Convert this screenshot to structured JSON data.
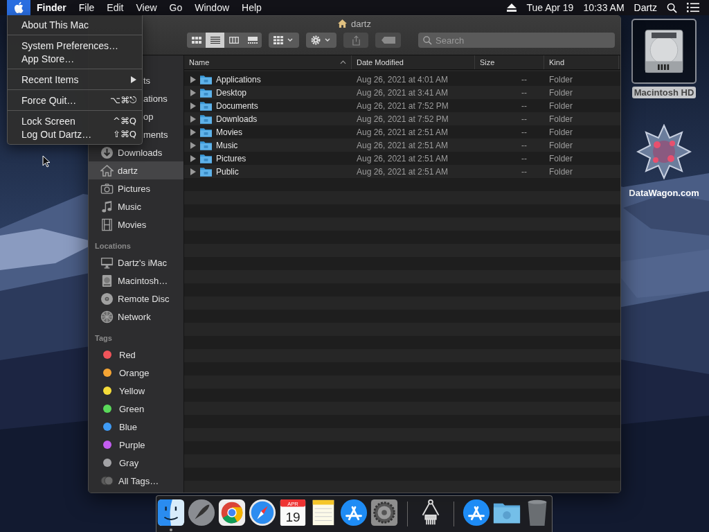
{
  "menu_bar": {
    "apple_selected": true,
    "app_name": "Finder",
    "menus": [
      "File",
      "Edit",
      "View",
      "Go",
      "Window",
      "Help"
    ],
    "date": "Tue Apr 19",
    "time": "10:33 AM",
    "user": "Dartz"
  },
  "apple_menu": {
    "groups": [
      [
        {
          "label": "About This Mac",
          "submenu": false
        }
      ],
      [
        {
          "label": "System Preferences…",
          "submenu": false
        },
        {
          "label": "App Store…",
          "submenu": false
        }
      ],
      [
        {
          "label": "Recent Items",
          "submenu": true
        }
      ],
      [
        {
          "label": "Force Quit…",
          "submenu": false,
          "shortcut": "⌥⌘⎋"
        }
      ],
      [
        {
          "label": "Lock Screen",
          "submenu": false,
          "shortcut": "^⌘Q"
        },
        {
          "label": "Log Out Dartz…",
          "submenu": false,
          "shortcut": "⇧⌘Q"
        }
      ]
    ]
  },
  "desktop_icons": [
    {
      "label": "Macintosh HD",
      "selected": true
    },
    {
      "label": "DataWagon.com",
      "selected": false
    }
  ],
  "finder_window": {
    "title": "dartz",
    "view_modes": [
      {
        "selected": false
      },
      {
        "selected": true
      },
      {
        "selected": false
      },
      {
        "selected": false
      }
    ],
    "toolbar_buttons": [
      {
        "kind": "group",
        "disabled": false
      },
      {
        "kind": "action",
        "disabled": false
      },
      {
        "kind": "share",
        "disabled": true
      },
      {
        "kind": "tags",
        "disabled": true
      }
    ],
    "search": {
      "placeholder": "Search"
    },
    "sidebar": [
      {
        "items": [
          {
            "kind": "covered",
            "label": "ts",
            "selected": false
          },
          {
            "kind": "covered",
            "label": "ations",
            "selected": false
          },
          {
            "kind": "covered",
            "label": "op",
            "selected": false
          },
          {
            "kind": "covered",
            "label": "ments",
            "selected": false
          },
          {
            "kind": "item",
            "label": "Downloads",
            "selected": false
          },
          {
            "kind": "item",
            "label": "dartz",
            "selected": true
          },
          {
            "kind": "item",
            "label": "Pictures",
            "selected": false
          },
          {
            "kind": "item",
            "label": "Music",
            "selected": false
          },
          {
            "kind": "item",
            "label": "Movies",
            "selected": false
          }
        ]
      },
      {
        "header": "Locations",
        "items": [
          {
            "kind": "item",
            "label": "Dartz's iMac",
            "selected": false
          },
          {
            "kind": "item",
            "label": "Macintosh…",
            "selected": false
          },
          {
            "kind": "item",
            "label": "Remote Disc",
            "selected": false
          },
          {
            "kind": "item",
            "label": "Network",
            "selected": false
          }
        ]
      },
      {
        "header": "Tags",
        "items": [
          {
            "kind": "tag",
            "label": "Red",
            "color": "#f0545a",
            "selected": false
          },
          {
            "kind": "tag",
            "label": "Orange",
            "color": "#f5a534",
            "selected": false
          },
          {
            "kind": "tag",
            "label": "Yellow",
            "color": "#f5dc3a",
            "selected": false
          },
          {
            "kind": "tag",
            "label": "Green",
            "color": "#5ad95a",
            "selected": false
          },
          {
            "kind": "tag",
            "label": "Blue",
            "color": "#3f9bf5",
            "selected": false
          },
          {
            "kind": "tag",
            "label": "Purple",
            "color": "#c35df0",
            "selected": false
          },
          {
            "kind": "tag",
            "label": "Gray",
            "color": "#a3a3a6",
            "selected": false
          },
          {
            "kind": "all",
            "label": "All Tags…",
            "selected": false
          }
        ]
      }
    ],
    "columns": [
      {
        "label": "Name",
        "sorted": true
      },
      {
        "label": "Date Modified",
        "sorted": false
      },
      {
        "label": "Size",
        "sorted": false
      },
      {
        "label": "Kind",
        "sorted": false
      }
    ],
    "rows": [
      {
        "name": "Applications",
        "date_modified": "Aug 26, 2021 at 4:01 AM",
        "size": "--",
        "file_kind": "Folder"
      },
      {
        "name": "Desktop",
        "date_modified": "Aug 26, 2021 at 3:41 AM",
        "size": "--",
        "file_kind": "Folder"
      },
      {
        "name": "Documents",
        "date_modified": "Aug 26, 2021 at 7:52 PM",
        "size": "--",
        "file_kind": "Folder"
      },
      {
        "name": "Downloads",
        "date_modified": "Aug 26, 2021 at 7:52 PM",
        "size": "--",
        "file_kind": "Folder"
      },
      {
        "name": "Movies",
        "date_modified": "Aug 26, 2021 at 2:51 AM",
        "size": "--",
        "file_kind": "Folder"
      },
      {
        "name": "Music",
        "date_modified": "Aug 26, 2021 at 2:51 AM",
        "size": "--",
        "file_kind": "Folder"
      },
      {
        "name": "Pictures",
        "date_modified": "Aug 26, 2021 at 2:51 AM",
        "size": "--",
        "file_kind": "Folder"
      },
      {
        "name": "Public",
        "date_modified": "Aug 26, 2021 at 2:51 AM",
        "size": "--",
        "file_kind": "Folder"
      }
    ]
  },
  "dock": {
    "items": [
      {
        "kind": "finder",
        "running": true
      },
      {
        "kind": "launchpad",
        "running": false
      },
      {
        "kind": "chrome",
        "running": false
      },
      {
        "kind": "safari",
        "running": false
      },
      {
        "kind": "calendar",
        "running": false,
        "month": "APR",
        "day": "19"
      },
      {
        "kind": "notes",
        "running": false
      },
      {
        "kind": "appstore",
        "running": false
      },
      {
        "kind": "settings",
        "running": false
      },
      {
        "kind": "separator"
      },
      {
        "kind": "calipers",
        "running": false
      },
      {
        "kind": "separator"
      },
      {
        "kind": "appstore",
        "running": false
      },
      {
        "kind": "folder",
        "running": false
      },
      {
        "kind": "trash",
        "running": false
      }
    ]
  }
}
